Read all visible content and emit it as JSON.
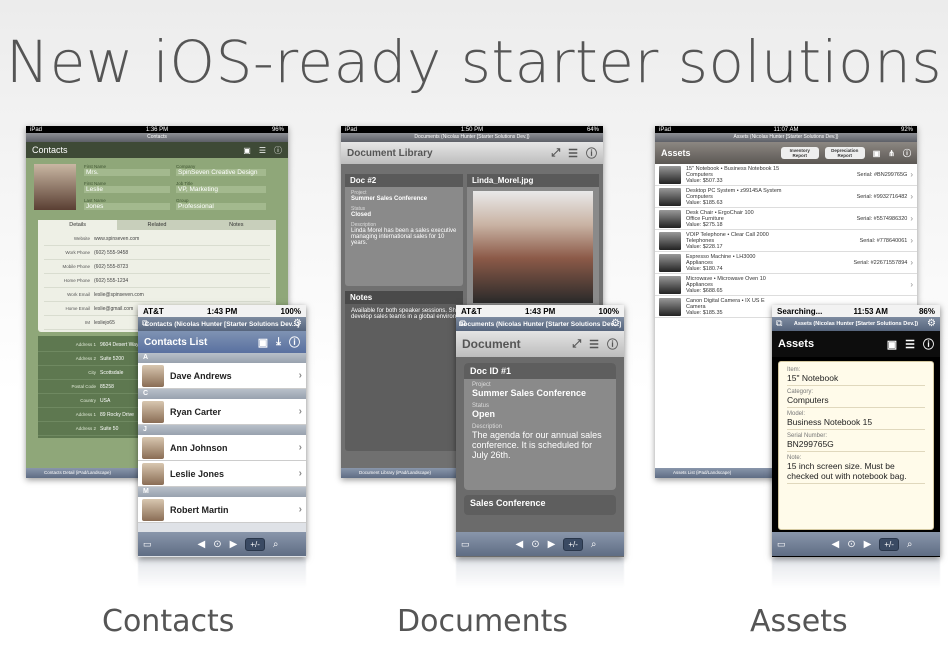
{
  "headline": "New iOS-ready starter solutions",
  "captions": {
    "contacts": "Contacts",
    "documents": "Documents",
    "assets": "Assets"
  },
  "colors": {
    "accent": "#56657d",
    "contacts_bg": "#8fa779",
    "docs_bg": "#6b6b6b",
    "assets_header": "#6e6a66"
  },
  "contacts_ipad": {
    "status_left": "iPad",
    "status_time": "1:36 PM",
    "status_right": "96%",
    "window_title": "Contacts",
    "header_title": "Contacts",
    "fields": [
      {
        "label": "First Name",
        "value": "Mrs."
      },
      {
        "label": "Company",
        "value": "SpinSeven Creative Design"
      },
      {
        "label": "First Name",
        "value": "Leslie"
      },
      {
        "label": "Job Title",
        "value": "VP, Marketing"
      },
      {
        "label": "Last Name",
        "value": "Jones"
      },
      {
        "label": "Group",
        "value": "Professional"
      }
    ],
    "tabs": [
      "Details",
      "Related",
      "Notes"
    ],
    "detail_rows": [
      {
        "label": "Website",
        "value": "www.spinseven.com"
      },
      {
        "label": "Work Phone",
        "value": "(602) 555-9458"
      },
      {
        "label": "Mobile Phone",
        "value": "(602) 555-8723"
      },
      {
        "label": "Home Phone",
        "value": "(602) 555-1234"
      },
      {
        "label": "Work Email",
        "value": "leslie@spinseven.com"
      },
      {
        "label": "Home Email",
        "value": "leslie@gmail.com"
      },
      {
        "label": "IM",
        "value": "lesliejo65"
      }
    ],
    "address_rows": [
      {
        "label": "Address 1",
        "value": "9604 Desert Way"
      },
      {
        "label": "Address 2",
        "value": "Suite 5200"
      },
      {
        "label": "City",
        "value": "Scottsdale"
      },
      {
        "label": "Postal Code",
        "value": "85258"
      },
      {
        "label": "Country",
        "value": "USA"
      },
      {
        "label": "Address 1",
        "value": "89 Rocky Drive"
      },
      {
        "label": "Address 2",
        "value": "Suite 50"
      }
    ],
    "bottom_title": "Contacts Detail (iPad/Landscape)"
  },
  "contacts_iphone": {
    "carrier": "AT&T",
    "time": "1:43 PM",
    "battery": "100%",
    "window_title": "Contacts (Nicolas Hunter [Starter Solutions Dev...]",
    "header_title": "Contacts List",
    "groups": [
      {
        "letter": "A",
        "names": [
          "Dave Andrews"
        ]
      },
      {
        "letter": "C",
        "names": [
          "Ryan Carter"
        ]
      },
      {
        "letter": "J",
        "names": [
          "Ann Johnson",
          "Leslie Jones"
        ]
      },
      {
        "letter": "M",
        "names": [
          "Robert Martin"
        ]
      }
    ],
    "toolbar_plusminus": "+/-"
  },
  "docs_ipad": {
    "status_left": "iPad",
    "status_time": "1:50 PM",
    "status_right": "64%",
    "window_title": "Documents (Nicolas Hunter [Starter Solutions Dev.])",
    "header_title": "Document Library",
    "doc_card_title": "Doc #2",
    "project_label": "Project",
    "project_value": "Summer Sales Conference",
    "status_label": "Status",
    "status_value": "Closed",
    "desc_label": "Description",
    "desc_value": "Linda Morel has been a sales executive managing international sales for 10 years.",
    "image_title": "Linda_Morel.jpg",
    "notes_title": "Notes",
    "notes_text": "Available for both speaker sessions. She will speak about how to develop sales teams in a global environment.",
    "bottom_title": "Document Library (iPad/Landscape)"
  },
  "docs_iphone": {
    "carrier": "AT&T",
    "time": "1:43 PM",
    "battery": "100%",
    "window_title": "Documents (Nicolas Hunter [Starter Solutions Dev...]",
    "header_title": "Document",
    "card_title": "Doc ID #1",
    "project_label": "Project",
    "project_value": "Summer Sales Conference",
    "status_label": "Status",
    "status_value": "Open",
    "desc_label": "Description",
    "desc_value": "The agenda for our annual sales conference. It is scheduled for July 26th.",
    "section2": "Sales Conference",
    "toolbar_plusminus": "+/-"
  },
  "assets_ipad": {
    "status_left": "iPad",
    "status_time": "11:07 AM",
    "status_right": "92%",
    "window_title": "Assets (Nicolas Hunter [Starter Solutions Dev.])",
    "header_title": "Assets",
    "btn_inventory": "Inventory Report",
    "btn_depreciation": "Depreciation Report",
    "items": [
      {
        "name": "15\" Notebook • Business Notebook 15",
        "category": "Computers",
        "value": "Value: $507.33",
        "serial": "Serial: #BN299765G"
      },
      {
        "name": "Desktop PC System • z99145A System",
        "category": "Computers",
        "value": "Value: $185.63",
        "serial": "Serial: #9932716482"
      },
      {
        "name": "Desk Chair • ErgoChair 100",
        "category": "Office Furniture",
        "value": "Value: $275.18",
        "serial": "Serial: #5574986320"
      },
      {
        "name": "VOIP Telephone • Clear Call 2000",
        "category": "Telephones",
        "value": "Value: $228.17",
        "serial": "Serial: #778640061"
      },
      {
        "name": "Espresso Machine • LH3000",
        "category": "Appliances",
        "value": "Value: $180.74",
        "serial": "Serial: #22671557894"
      },
      {
        "name": "Microwave • Microwave Oven 10",
        "category": "Appliances",
        "value": "Value: $688.65",
        "serial": ""
      },
      {
        "name": "Canon Digital Camera • IX US E",
        "category": "Camera",
        "value": "Value: $185.35",
        "serial": ""
      }
    ],
    "bottom_title": "Assets List (iPad/Landscape)"
  },
  "assets_iphone": {
    "carrier": "Searching...",
    "time": "11:53 AM",
    "battery": "86%",
    "window_title": "Assets (Nicolas Hunter [Starter Solutions Dev.])",
    "header_title": "Assets",
    "fields": [
      {
        "label": "Item:",
        "value": "15\" Notebook"
      },
      {
        "label": "Category:",
        "value": "Computers"
      },
      {
        "label": "Model:",
        "value": "Business Notebook 15"
      },
      {
        "label": "Serial Number:",
        "value": "BN299765G"
      },
      {
        "label": "Note:",
        "value": "15 inch screen size. Must be checked out with notebook bag."
      }
    ],
    "toolbar_plusminus": "+/-"
  }
}
